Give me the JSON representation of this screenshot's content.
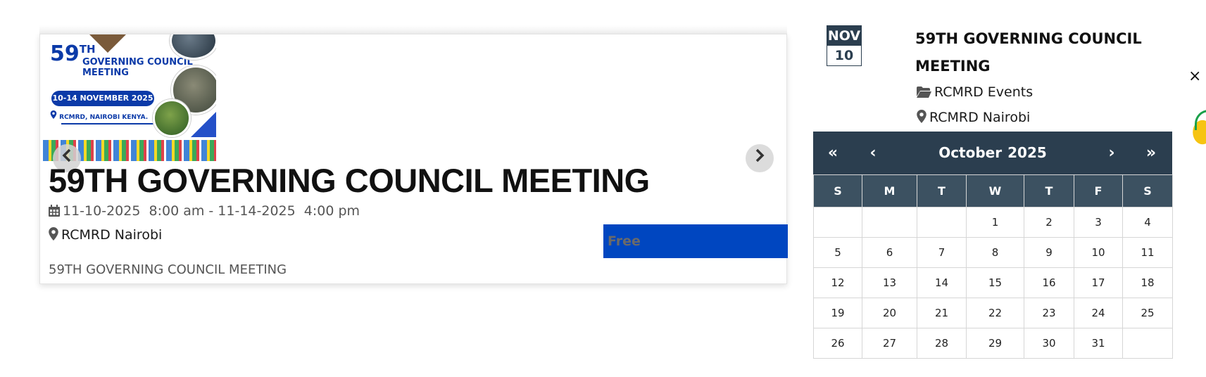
{
  "event_card": {
    "poster": {
      "number": "59",
      "number_suffix": "TH",
      "title_line1": "GOVERNING COUNCIL",
      "title_line2": "MEETING",
      "dates": "10-14 NOVEMBER 2025",
      "location": "RCMRD, NAIROBI KENYA."
    },
    "prev_icon": "chevron-left-icon",
    "next_icon": "chevron-right-icon",
    "title": "59TH GOVERNING COUNCIL MEETING",
    "date_range": "11-10-2025  8:00 am - 11-14-2025  4:00 pm",
    "location": "RCMRD Nairobi",
    "description": "59TH GOVERNING COUNCIL MEETING",
    "price_label": "Free",
    "price_bg": "#0046c0"
  },
  "widget": {
    "date_month": "NOV",
    "date_day": "10",
    "title": "59TH GOVERNING COUNCIL MEETING",
    "category": "RCMRD Events",
    "location": "RCMRD Nairobi",
    "close_label": "×"
  },
  "calendar": {
    "prev_year_label": "«",
    "prev_month_label": "‹",
    "next_month_label": "›",
    "next_year_label": "»",
    "month": "October",
    "year": "2025",
    "header_color": "#2b3e4f",
    "weekdays": [
      "S",
      "M",
      "T",
      "W",
      "T",
      "F",
      "S"
    ],
    "weeks": [
      [
        "",
        "",
        "",
        "1",
        "2",
        "3",
        "4"
      ],
      [
        "5",
        "6",
        "7",
        "8",
        "9",
        "10",
        "11"
      ],
      [
        "12",
        "13",
        "14",
        "15",
        "16",
        "17",
        "18"
      ],
      [
        "19",
        "20",
        "21",
        "22",
        "23",
        "24",
        "25"
      ],
      [
        "26",
        "27",
        "28",
        "29",
        "30",
        "31",
        ""
      ]
    ]
  }
}
